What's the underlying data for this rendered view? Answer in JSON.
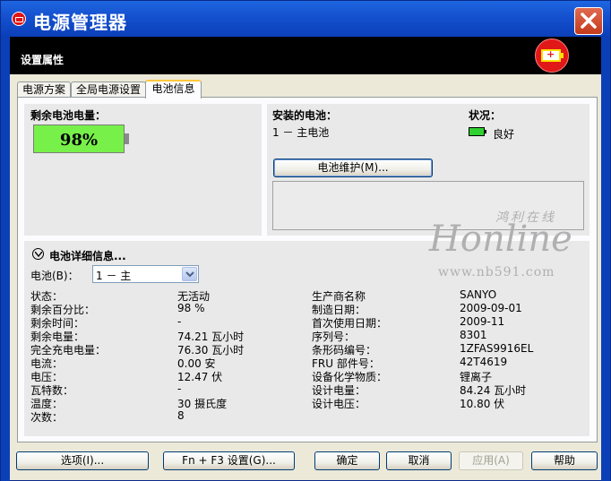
{
  "window": {
    "title": "电源管理器"
  },
  "header": {
    "label": "设置属性"
  },
  "tabs": [
    {
      "label": "电源方案"
    },
    {
      "label": "全局电源设置"
    },
    {
      "label": "电池信息"
    }
  ],
  "remaining": {
    "label": "剩余电池电量：",
    "percent_text": "98%",
    "percent_value": 98
  },
  "installed": {
    "label": "安装的电池：",
    "item": "1 － 主电池"
  },
  "status": {
    "label": "状况：",
    "value": "良好"
  },
  "maintain_button": "电池维护(M)...",
  "details": {
    "title": "电池详细信息...",
    "battery_label": "电池(B)：",
    "battery_select": "1 － 主",
    "left_rows": [
      {
        "label": "状态：",
        "value": "无活动"
      },
      {
        "label": "剩余百分比：",
        "value": "98 %"
      },
      {
        "label": "剩余时间：",
        "value": "-"
      },
      {
        "label": "剩余电量：",
        "value": "74.21 瓦小时"
      },
      {
        "label": "完全充电电量：",
        "value": "76.30 瓦小时"
      },
      {
        "label": "电流：",
        "value": "0.00 安"
      },
      {
        "label": "电压：",
        "value": "12.47 伏"
      },
      {
        "label": "瓦特数：",
        "value": "-"
      },
      {
        "label": "温度：",
        "value": "30 摄氏度"
      },
      {
        "label": "次数：",
        "value": "8"
      }
    ],
    "right_rows": [
      {
        "label": "生产商名称",
        "value": "SANYO"
      },
      {
        "label": "制造日期：",
        "value": "2009-09-01"
      },
      {
        "label": "首次使用日期：",
        "value": "2009-11"
      },
      {
        "label": "序列号：",
        "value": "8301"
      },
      {
        "label": "条形码编号：",
        "value": "1ZFAS9916EL"
      },
      {
        "label": "FRU 部件号：",
        "value": "42T4619"
      },
      {
        "label": "设备化学物质：",
        "value": "锂离子"
      },
      {
        "label": "设计电量：",
        "value": "84.24 瓦小时"
      },
      {
        "label": "设计电压：",
        "value": "10.80 伏"
      }
    ]
  },
  "watermark": {
    "cn": "鸿利在线",
    "main": "Honline",
    "url": "www.nb591.com"
  },
  "footer": {
    "options": "选项(I)...",
    "fn_f3": "Fn + F3 设置(G)...",
    "ok": "确定",
    "cancel": "取消",
    "apply": "应用(A)",
    "help": "帮助"
  },
  "colors": {
    "battery_green": "#78f04a",
    "title_blue": "#1552d1"
  }
}
